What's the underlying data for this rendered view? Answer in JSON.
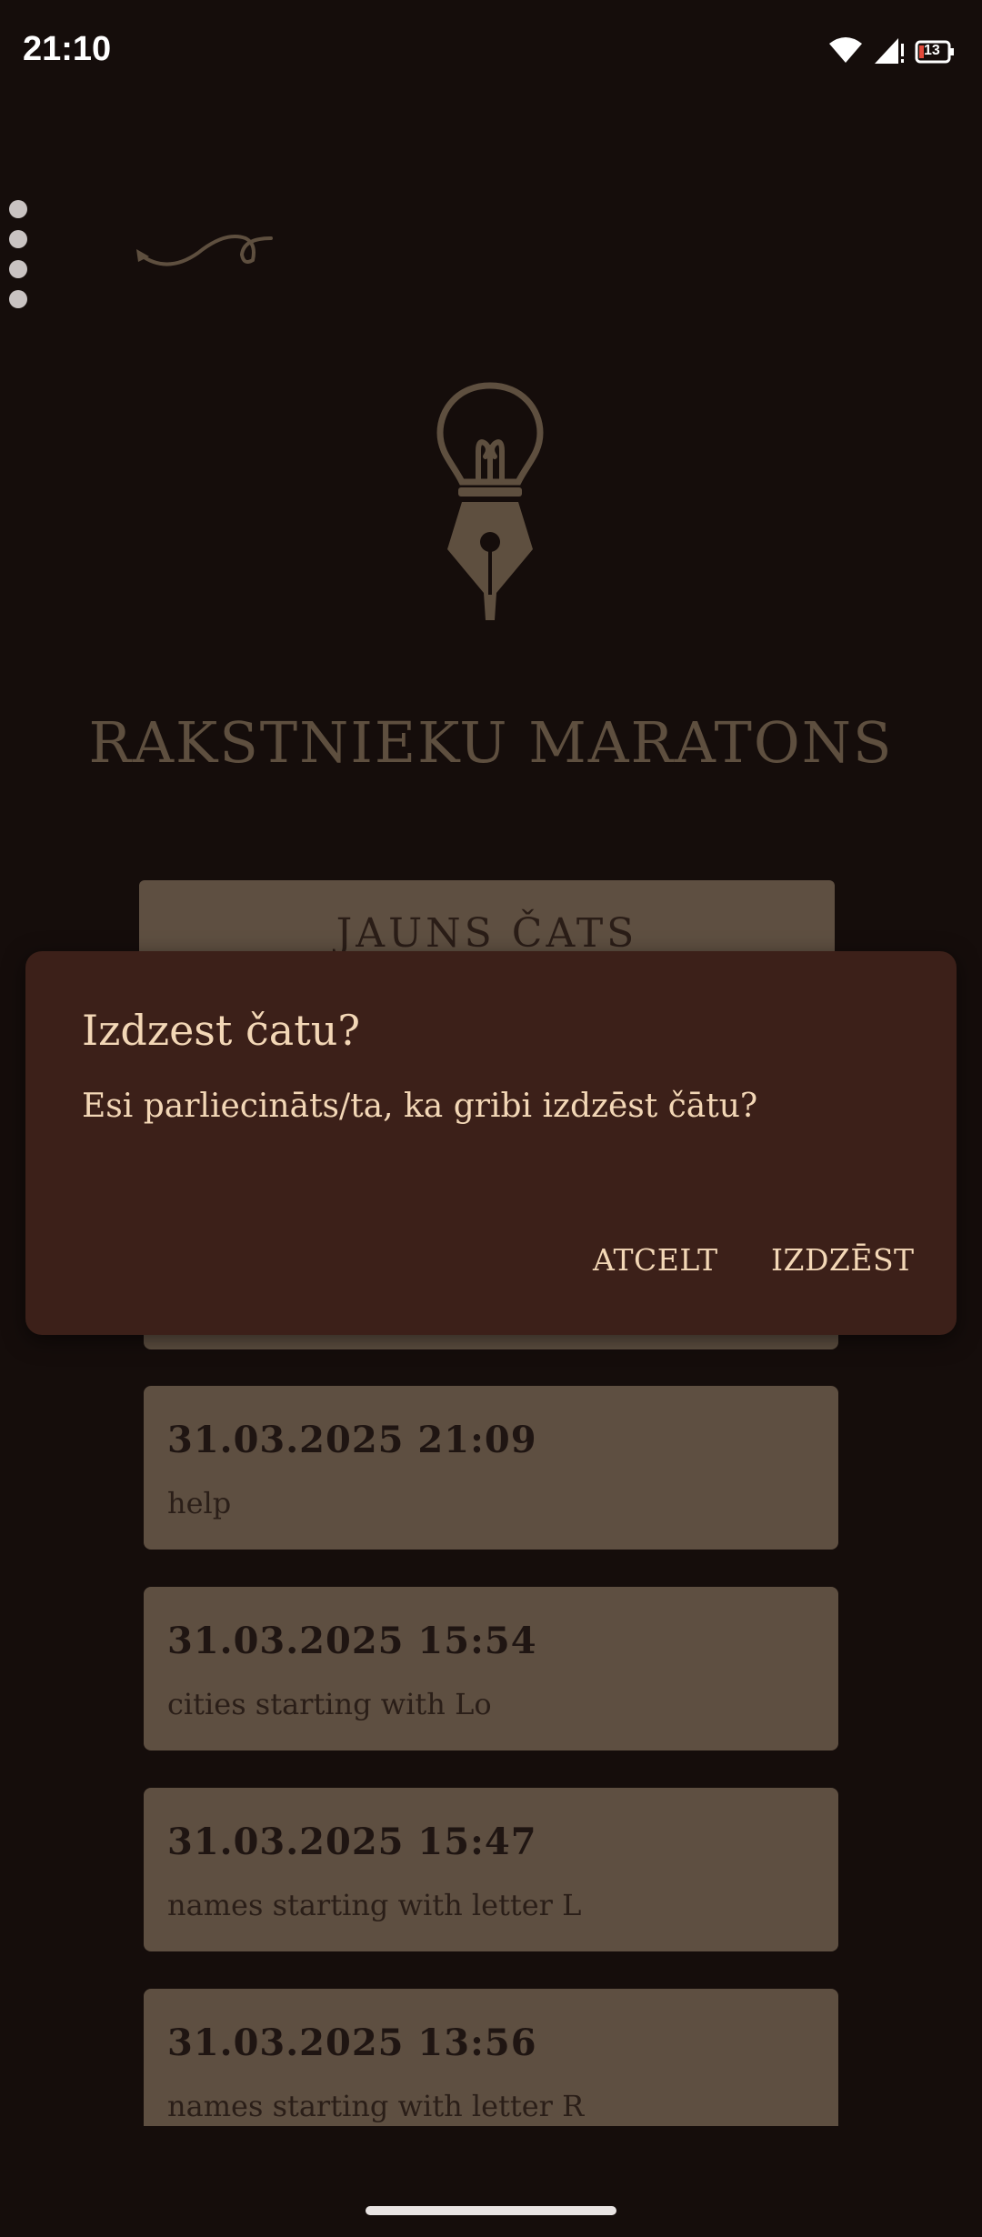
{
  "status_bar": {
    "time": "21:10",
    "battery": "13"
  },
  "icons": {
    "wifi": "wifi-icon",
    "signal": "signal-icon",
    "battery": "battery-icon",
    "menu": "more-vertical-icon",
    "swirl": "swirl-arrow-icon",
    "logo": "lightbulb-fountain-pen-icon"
  },
  "app": {
    "title": "RAKSTNIEKU MARATONS",
    "new_chat_label": "JAUNS ČATS"
  },
  "chats": [
    {
      "date": "31.03.2025 21:09",
      "subtitle": "help"
    },
    {
      "date": "31.03.2025 15:54",
      "subtitle": "cities starting with Lo"
    },
    {
      "date": "31.03.2025 15:47",
      "subtitle": "names starting with letter L"
    },
    {
      "date": "31.03.2025 13:56",
      "subtitle": "names starting with letter R"
    }
  ],
  "dialog": {
    "title": "Izdzest čatu?",
    "message": "Esi parliecināts/ta, ka gribi izdzēst čātu?",
    "cancel_label": "ATCELT",
    "delete_label": "IZDZĒST"
  },
  "colors": {
    "background": "#150d0b",
    "card": "#5e4f41",
    "dialog": "#3c2019",
    "dialog_text": "#f3d7b6",
    "title": "#5e4f3f"
  }
}
